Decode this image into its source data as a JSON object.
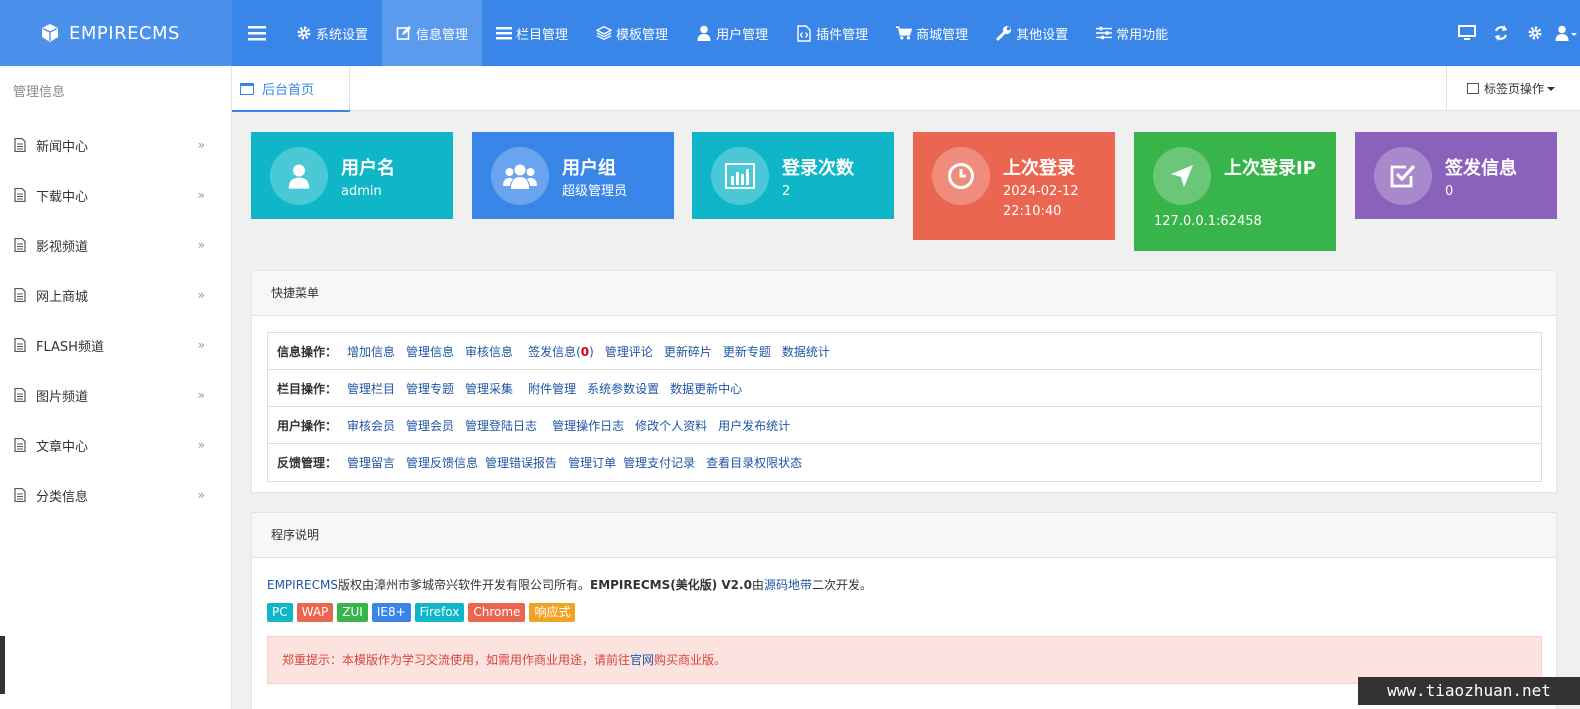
{
  "brand": {
    "name": "EMPIRECMS"
  },
  "nav": [
    {
      "label": "系统设置",
      "icon": "gear-icon"
    },
    {
      "label": "信息管理",
      "icon": "edit-icon"
    },
    {
      "label": "栏目管理",
      "icon": "list-icon"
    },
    {
      "label": "模板管理",
      "icon": "layers-icon"
    },
    {
      "label": "用户管理",
      "icon": "user-icon"
    },
    {
      "label": "插件管理",
      "icon": "code-file-icon"
    },
    {
      "label": "商城管理",
      "icon": "cart-icon"
    },
    {
      "label": "其他设置",
      "icon": "wrench-icon"
    },
    {
      "label": "常用功能",
      "icon": "sliders-icon"
    }
  ],
  "active_nav": "信息管理",
  "top_right_icons": [
    "monitor-icon",
    "refresh-icon",
    "gear-icon",
    "user-icon"
  ],
  "sidebar": {
    "title": "管理信息",
    "items": [
      {
        "label": "新闻中心"
      },
      {
        "label": "下载中心"
      },
      {
        "label": "影视频道"
      },
      {
        "label": "网上商城"
      },
      {
        "label": "FLASH频道"
      },
      {
        "label": "图片频道"
      },
      {
        "label": "文章中心"
      },
      {
        "label": "分类信息"
      }
    ]
  },
  "tabbar": {
    "tab": "后台首页",
    "ops": "标签页操作"
  },
  "cards": [
    {
      "title": "用户名",
      "value": "admin",
      "color": "#0fb6c8",
      "icon": "user-icon"
    },
    {
      "title": "用户组",
      "value": "超级管理员",
      "color": "#3a86e8",
      "icon": "users-icon"
    },
    {
      "title": "登录次数",
      "value": "2",
      "color": "#0fb6c8",
      "icon": "bar-chart-icon"
    },
    {
      "title": "上次登录",
      "value": "2024-02-12 22:10:40",
      "color": "#ea6650",
      "icon": "clock-icon"
    },
    {
      "title": "上次登录IP",
      "value": "127.0.0.1:62458",
      "color": "#37b44a",
      "icon": "location-arrow-icon"
    },
    {
      "title": "签发信息",
      "value": "0",
      "color": "#8a62bb",
      "icon": "check-square-icon"
    }
  ],
  "quick": {
    "title": "快捷菜单",
    "rows": [
      {
        "label": "信息操作：",
        "links": [
          "增加信息",
          "管理信息",
          "审核信息",
          "签发信息(",
          "管理评论",
          "更新碎片",
          "更新专题",
          "数据统计"
        ],
        "pending_count": "0"
      },
      {
        "label": "栏目操作：",
        "links": [
          "管理栏目",
          "管理专题",
          "管理采集",
          "附件管理",
          "系统参数设置",
          "数据更新中心"
        ]
      },
      {
        "label": "用户操作：",
        "links": [
          "审核会员",
          "管理会员",
          "管理登陆日志",
          "管理操作日志",
          "修改个人资料",
          "用户发布统计"
        ]
      },
      {
        "label": "反馈管理：",
        "links": [
          "管理留言",
          "管理反馈信息",
          "管理错误报告",
          "管理订单",
          "管理支付记录",
          "查看目录权限状态"
        ]
      }
    ]
  },
  "program": {
    "title": "程序说明",
    "line_brand": "EMPIRECMS",
    "line_text1": "版权由漳州市爹城帝兴软件开发有限公司所有。",
    "line_bold": "EMPIRECMS(美化版) V2.0",
    "line_text2": "由",
    "line_link": "源码地带",
    "line_text3": "二次开发。",
    "badges": [
      {
        "label": "PC",
        "color": "#0fb6c8"
      },
      {
        "label": "WAP",
        "color": "#ea6650"
      },
      {
        "label": "ZUI",
        "color": "#37b44a"
      },
      {
        "label": "IE8+",
        "color": "#3a86e8"
      },
      {
        "label": "Firefox",
        "color": "#0fb6c8"
      },
      {
        "label": "Chrome",
        "color": "#ea6650"
      },
      {
        "label": "响应式",
        "color": "#f1a325"
      }
    ],
    "notice_text1": "郑重提示：本模版作为学习交流使用，如需用作商业用途，请前往",
    "notice_link": "官网",
    "notice_text2": "购买商业版。"
  },
  "watermark": "www.tiaozhuan.net"
}
